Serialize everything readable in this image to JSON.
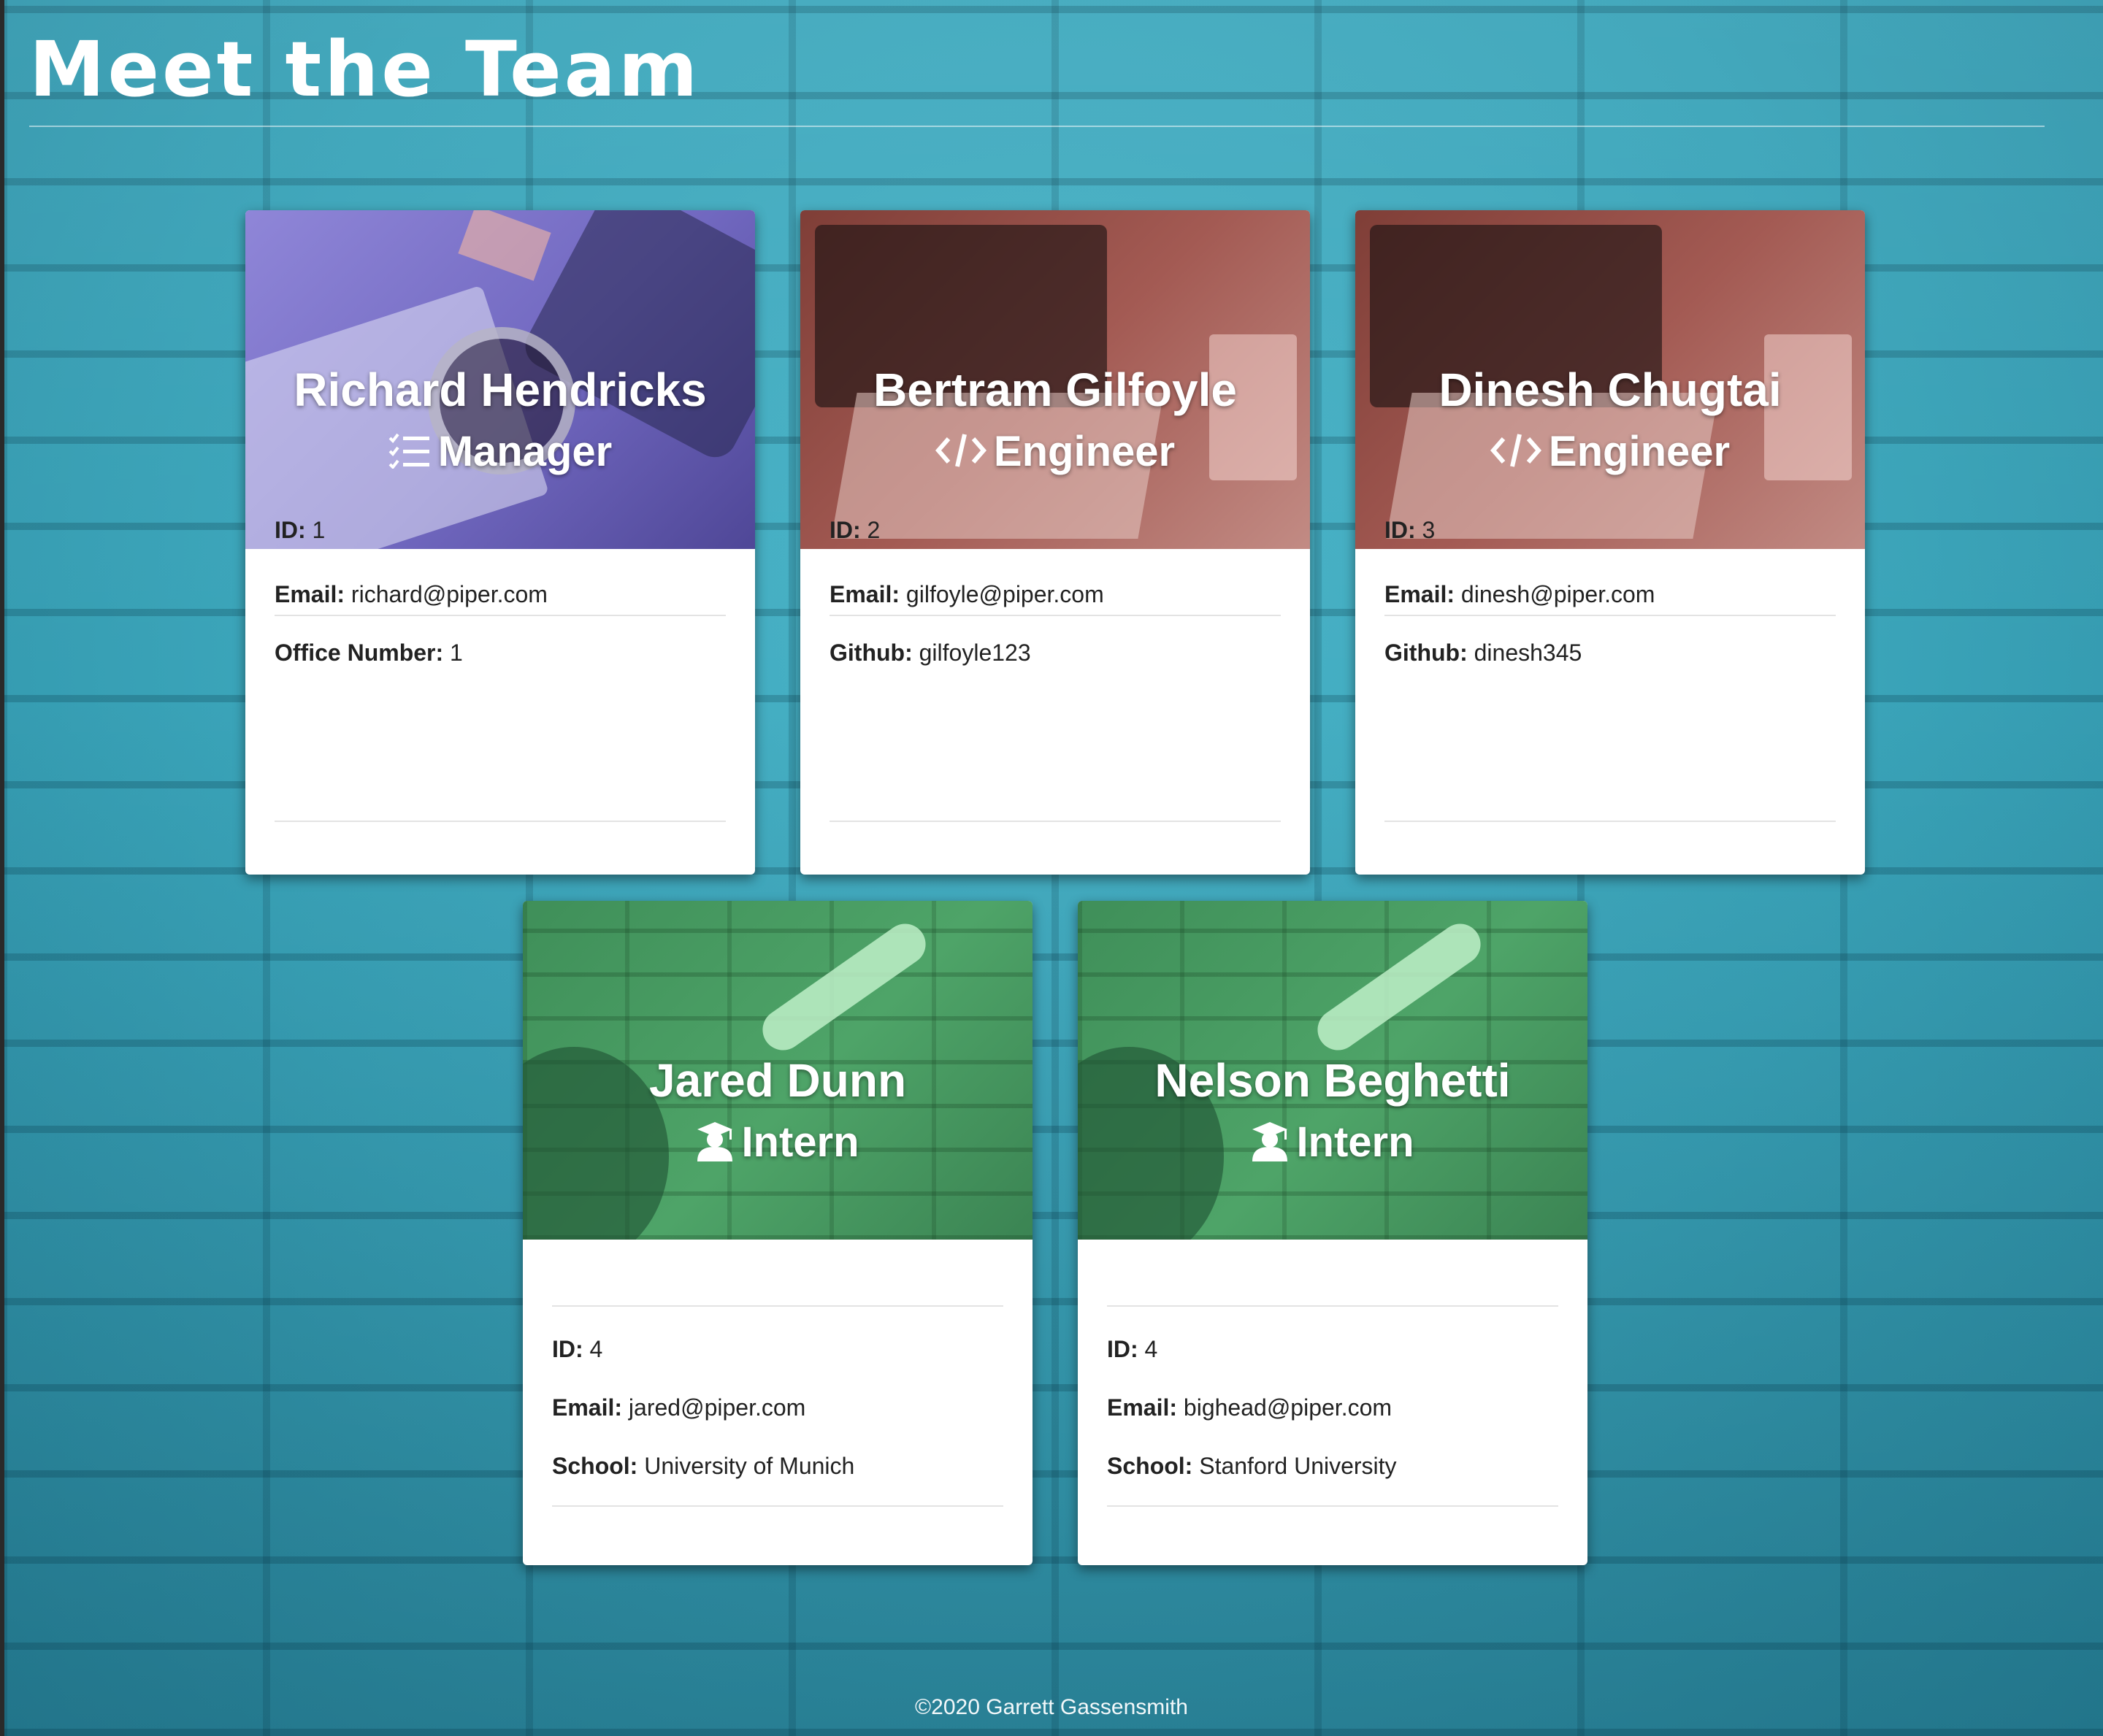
{
  "page": {
    "title": "Meet the Team",
    "footer": "©2020 Garrett Gassensmith"
  },
  "labels": {
    "id": "ID:",
    "email": "Email:",
    "office": "Office Number:",
    "github": "Github:",
    "school": "School:"
  },
  "employees": [
    {
      "name": "Richard Hendricks",
      "role": "Manager",
      "role_icon": "tasks-icon",
      "header_color": "#7168c0",
      "id": "1",
      "email": "richard@piper.com",
      "extra_label": "Office Number:",
      "extra_value": "1"
    },
    {
      "name": "Bertram Gilfoyle",
      "role": "Engineer",
      "role_icon": "code-icon",
      "header_color": "#a35a53",
      "id": "2",
      "email": "gilfoyle@piper.com",
      "extra_label": "Github:",
      "extra_value": "gilfoyle123"
    },
    {
      "name": "Dinesh Chugtai",
      "role": "Engineer",
      "role_icon": "code-icon",
      "header_color": "#a35a53",
      "id": "3",
      "email": "dinesh@piper.com",
      "extra_label": "Github:",
      "extra_value": "dinesh345"
    },
    {
      "name": "Jared Dunn",
      "role": "Intern",
      "role_icon": "graduate-icon",
      "header_color": "#4ea468",
      "id": "4",
      "email": "jared@piper.com",
      "extra_label": "School:",
      "extra_value": "University of Munich"
    },
    {
      "name": "Nelson Beghetti",
      "role": "Intern",
      "role_icon": "graduate-icon",
      "header_color": "#4ea468",
      "id": "4",
      "email": "bighead@piper.com",
      "extra_label": "School:",
      "extra_value": "Stanford University"
    }
  ]
}
